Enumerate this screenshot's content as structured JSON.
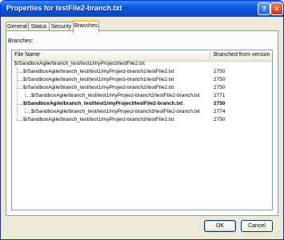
{
  "window": {
    "title": "Properties for testFile2-branch.txt",
    "help_label": "?",
    "close_label": "✕"
  },
  "tabs": [
    {
      "label": "General",
      "active": false
    },
    {
      "label": "Status",
      "active": false
    },
    {
      "label": "Security",
      "active": false
    },
    {
      "label": "Branches",
      "active": true
    }
  ],
  "branches": {
    "section_label": "Branches:",
    "columns": {
      "name": "File Name",
      "branched": "Branched from version"
    },
    "rows": [
      {
        "name": "$/SandboxAgile/branch_test/test1/myProject/testFile2.txt",
        "version": "",
        "depth": 0,
        "bold": false
      },
      {
        "name": "$/SandboxAgile/branch_test/test1/myProject-branch1/testFile2.txt",
        "version": "2750",
        "depth": 1,
        "bold": false
      },
      {
        "name": "$/SandboxAgile/branch_test/test1/myProject-branch1/testFile2.txt",
        "version": "2750",
        "depth": 1,
        "bold": false
      },
      {
        "name": "$/SandboxAgile/branch_test/test1/myProject-branch2/testFile2.txt",
        "version": "2750",
        "depth": 1,
        "bold": false
      },
      {
        "name": "$/SandboxAgile/branch_test/test1/myProject-branch2/testFile2-branch.txt",
        "version": "2771",
        "depth": 2,
        "bold": false
      },
      {
        "name": "$/SandboxAgile/branch_test/test1/myProject/testFile2-branch.txt",
        "version": "2750",
        "depth": 1,
        "bold": true
      },
      {
        "name": "$/SandboxAgile/branch_test/test1/myProject-branch3/testFile2-branch.txt",
        "version": "2774",
        "depth": 2,
        "bold": false
      },
      {
        "name": "$/SandboxAgile/branch_test/test1/myProject-branch3/testFile2.txt",
        "version": "2750",
        "depth": 1,
        "bold": false
      }
    ]
  },
  "buttons": {
    "ok": "OK",
    "cancel": "Cancel"
  }
}
